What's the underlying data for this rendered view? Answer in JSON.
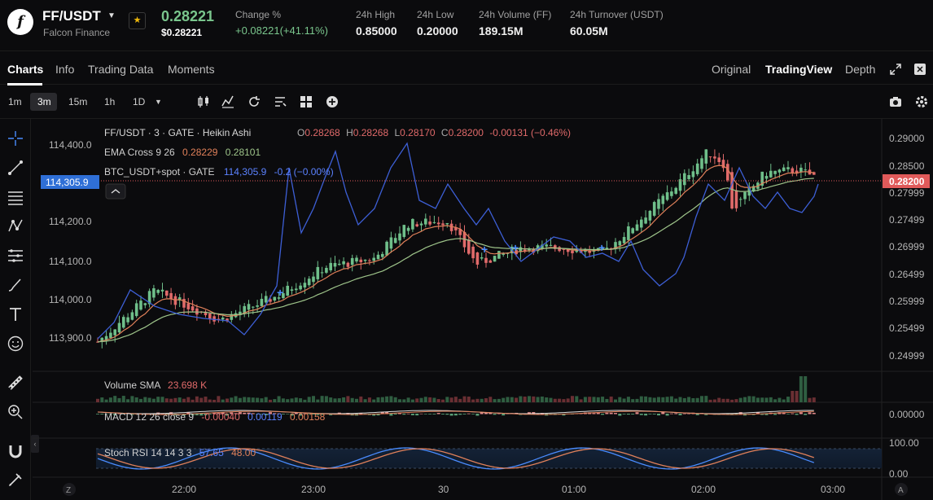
{
  "header": {
    "pair": "FF/USDT",
    "pair_subtitle": "Falcon Finance",
    "logo_letter": "f",
    "last_price": "0.28221",
    "last_price_usd": "$0.28221",
    "stats": [
      {
        "label": "Change %",
        "value": "+0.08221(+41.11%)",
        "color": "#7ac68d"
      },
      {
        "label": "24h High",
        "value": "0.85000"
      },
      {
        "label": "24h Low",
        "value": "0.20000"
      },
      {
        "label": "24h Volume (FF)",
        "value": "189.15M"
      },
      {
        "label": "24h Turnover (USDT)",
        "value": "60.05M"
      }
    ]
  },
  "tabs": [
    "Charts",
    "Info",
    "Trading Data",
    "Moments"
  ],
  "active_tab": "Charts",
  "views": [
    "Original",
    "TradingView",
    "Depth"
  ],
  "active_view": "TradingView",
  "timeframes": [
    "1m",
    "3m",
    "15m",
    "1h",
    "1D"
  ],
  "active_timeframe": "3m",
  "toolbar_icons": [
    "candle-style-icon",
    "indicators-icon",
    "replay-icon",
    "alert-icon",
    "layout-icon",
    "add-icon"
  ],
  "left_tools": [
    "crosshair-icon",
    "trend-line-icon",
    "fib-icon",
    "pattern-icon",
    "measure-lines-icon",
    "brush-icon",
    "text-icon",
    "emoji-icon",
    "ruler-icon",
    "zoom-icon",
    "magnet-icon",
    "lock-icon"
  ],
  "colors": {
    "up": "#6fbf8a",
    "down": "#e06a6a",
    "ema_fast": "#e0805a",
    "ema_slow": "#9ec48a",
    "btc": "#3d5fd6",
    "price_tag": "#e05a5a",
    "btc_tag": "#2f6fd6"
  },
  "chart": {
    "legend_main": {
      "title": "FF/USDT · 3 · GATE · Heikin Ashi",
      "o_label": "O",
      "o": "0.28268",
      "h_label": "H",
      "h": "0.28268",
      "l_label": "L",
      "l": "0.28170",
      "c_label": "C",
      "c": "0.28200",
      "change": "-0.00131 (−0.46%)"
    },
    "legend_ema": {
      "name": "EMA Cross 9 26",
      "v1": "0.28229",
      "v2": "0.28101"
    },
    "legend_btc": {
      "name": "BTC_USDT+spot · GATE",
      "value": "114,305.9",
      "change": "-0.2 (−0.00%)"
    },
    "legend_volume": {
      "name": "Volume SMA",
      "value": "23.698 K"
    },
    "legend_macd": {
      "name": "MACD 12 26 close 9",
      "v1": "-0.00040",
      "v2": "0.00119",
      "v3": "0.00158"
    },
    "legend_stoch": {
      "name": "Stoch RSI 14 14 3 3",
      "v1": "57.65",
      "v2": "48.00"
    },
    "left_axis": [
      "114,400.0",
      "114,200.0",
      "114,100.0",
      "114,000.0",
      "113,900.0"
    ],
    "right_axis": [
      "0.29000",
      "0.28500",
      "0.27999",
      "0.27499",
      "0.26999",
      "0.26499",
      "0.25999",
      "0.25499",
      "0.24999"
    ],
    "macd_axis": "0.00000",
    "stoch_axis": [
      "100.00",
      "0.00"
    ],
    "time_axis": [
      "22:00",
      "23:00",
      "30",
      "01:00",
      "02:00",
      "03:00"
    ],
    "current_price_tag": "0.28200",
    "btc_price_tag": "114,305.9",
    "axis_buttons": [
      "Z",
      "A"
    ]
  },
  "chart_data": {
    "type": "line",
    "title": "FF/USDT · 3 · GATE · Heikin Ashi",
    "xlabel": "",
    "ylabel": "",
    "x": [
      "22:00",
      "23:00",
      "30",
      "01:00",
      "02:00",
      "03:00"
    ],
    "ylim": [
      0.2475,
      0.2915
    ],
    "series": [
      {
        "name": "FF/USDT close",
        "values": [
          0.2559,
          0.2606,
          0.2735,
          0.2689,
          0.2858,
          0.282
        ]
      },
      {
        "name": "BTC_USDT+spot",
        "values": [
          113975,
          114050,
          114345,
          114230,
          114000,
          114305.9
        ]
      }
    ],
    "last": 0.282
  }
}
